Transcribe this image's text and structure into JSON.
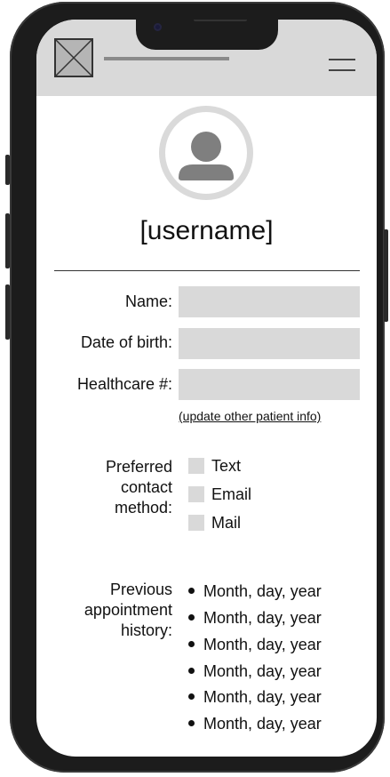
{
  "user": {
    "username": "[username]"
  },
  "form": {
    "name_label": "Name:",
    "name_value": "",
    "dob_label": "Date of birth:",
    "dob_value": "",
    "healthcare_label": "Healthcare #:",
    "healthcare_value": "",
    "update_link": "(update other patient info)"
  },
  "contact": {
    "label_lines": [
      "Preferred",
      "contact",
      "method:"
    ],
    "options": [
      "Text",
      "Email",
      "Mail"
    ]
  },
  "history": {
    "label_lines": [
      "Previous",
      "appointment",
      "history:"
    ],
    "items": [
      "Month, day, year",
      "Month, day, year",
      "Month, day, year",
      "Month, day, year",
      "Month, day, year",
      "Month, day, year"
    ]
  },
  "icons": {
    "logo": "image-placeholder-icon",
    "menu": "hamburger-menu-icon",
    "avatar": "user-avatar-icon"
  },
  "colors": {
    "placeholder_gray": "#d9d9d9",
    "frame": "#1c1c1c"
  }
}
